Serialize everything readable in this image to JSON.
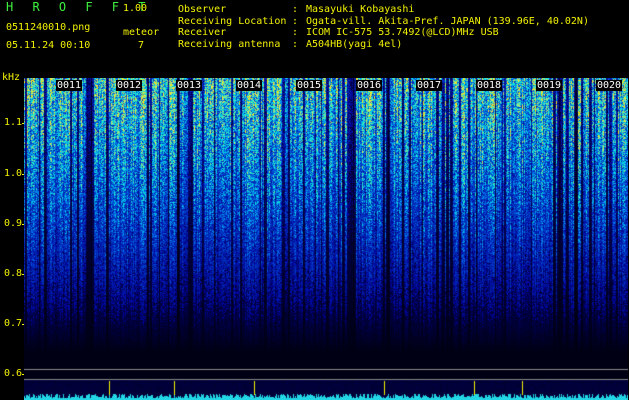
{
  "header": {
    "app_title": "H R O F F T",
    "version": "1.00",
    "filename": "0511240010.png",
    "datetime": "05.11.24 00:10",
    "meteor_label": "meteor",
    "meteor_count": "7"
  },
  "meta": [
    {
      "key": "Observer",
      "value": "Masayuki Kobayashi"
    },
    {
      "key": "Receiving Location",
      "value": "Ogata-vill. Akita-Pref. JAPAN (139.96E, 40.02N)"
    },
    {
      "key": "Receiver",
      "value": "ICOM IC-575 53.7492(@LCD)MHz USB"
    },
    {
      "key": "Receiving antenna",
      "value": "A504HB(yagi 4el)"
    }
  ],
  "axis": {
    "unit": "kHz",
    "ticks": [
      "1.1",
      "1.0",
      "0.9",
      "0.8",
      "0.7",
      "0.6"
    ],
    "minutes": [
      "0011",
      "0012",
      "0013",
      "0014",
      "0015",
      "0016",
      "0017",
      "0018",
      "0019",
      "0020"
    ]
  },
  "colors": {
    "label_yellow": "#f2f200",
    "title_green": "#3ef03e"
  }
}
